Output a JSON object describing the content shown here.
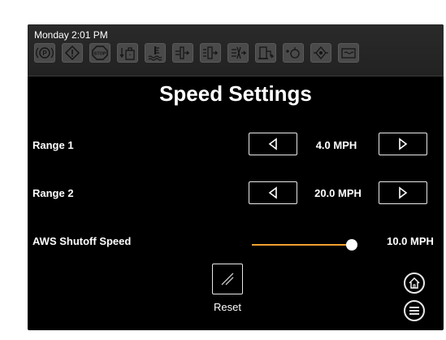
{
  "status_bar": {
    "datetime": "Monday 2:01 PM",
    "telltales": [
      {
        "name": "park-brake-icon"
      },
      {
        "name": "warning-icon"
      },
      {
        "name": "stop-icon"
      },
      {
        "name": "hydraulic-oil-level-icon"
      },
      {
        "name": "coolant-temp-icon"
      },
      {
        "name": "hydraulic-filter-icon"
      },
      {
        "name": "transmission-filter-icon"
      },
      {
        "name": "air-filter-icon"
      },
      {
        "name": "fuel-level-icon"
      },
      {
        "name": "engine-oil-icon"
      },
      {
        "name": "oil-pressure-icon"
      },
      {
        "name": "alternator-icon"
      }
    ]
  },
  "page": {
    "title": "Speed Settings"
  },
  "settings": {
    "range1": {
      "label": "Range 1",
      "value": "4.0 MPH"
    },
    "range2": {
      "label": "Range 2",
      "value": "20.0 MPH"
    },
    "aws": {
      "label": "AWS Shutoff Speed",
      "value": "10.0 MPH",
      "slider_level": 1.0
    }
  },
  "actions": {
    "reset_label": "Reset"
  },
  "colors": {
    "accent": "#f0a030",
    "background": "#000000",
    "text": "#ffffff"
  }
}
